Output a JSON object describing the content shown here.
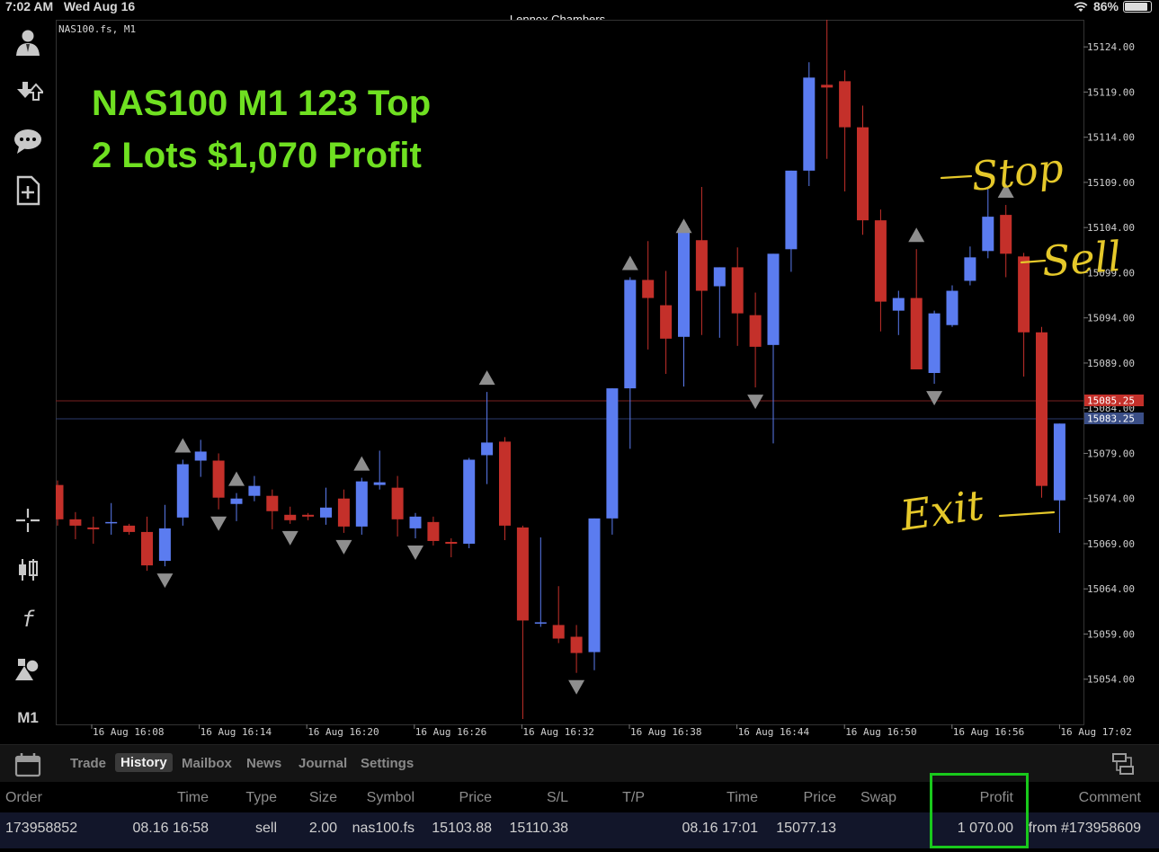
{
  "status_bar": {
    "time": "7:02 AM",
    "date": "Wed Aug 16",
    "account_name": "Lennox Chambers",
    "battery": "86%"
  },
  "chart": {
    "symbol_label": "NAS100.fs, M1",
    "overlay_title_1": "NAS100 M1 123 Top",
    "overlay_title_2": "2 Lots $1,070 Profit",
    "annotations": {
      "stop": "Stop",
      "sell": "Sell",
      "exit": "Exit"
    },
    "bid_label": "15085.25",
    "ask_label": "15083.25",
    "colors": {
      "bull": "#5b7cf0",
      "bear": "#c4302a",
      "arrow": "#8e8e8e",
      "overlay_text": "#6fe021",
      "annotation": "#e5c82a"
    }
  },
  "chart_data": {
    "type": "candlestick",
    "ylim": [
      15049,
      15127
    ],
    "y_ticks": [
      "15124.00",
      "15119.00",
      "15114.00",
      "15109.00",
      "15104.00",
      "15099.00",
      "15094.00",
      "15089.00",
      "15084.00",
      "15079.00",
      "15074.00",
      "15069.00",
      "15064.00",
      "15059.00",
      "15054.00"
    ],
    "x_ticks": [
      "16 Aug 16:08",
      "16 Aug 16:14",
      "16 Aug 16:20",
      "16 Aug 16:26",
      "16 Aug 16:32",
      "16 Aug 16:38",
      "16 Aug 16:44",
      "16 Aug 16:50",
      "16 Aug 16:56",
      "16 Aug 17:02"
    ],
    "candles": [
      {
        "o": 15075.5,
        "h": 15076,
        "l": 15071,
        "c": 15071.7
      },
      {
        "o": 15071.7,
        "h": 15072.5,
        "l": 15069.5,
        "c": 15071.0
      },
      {
        "o": 15070.8,
        "h": 15072,
        "l": 15069.0,
        "c": 15070.6
      },
      {
        "o": 15071.3,
        "h": 15073.5,
        "l": 15070,
        "c": 15071.4
      },
      {
        "o": 15071.0,
        "h": 15071.2,
        "l": 15070.0,
        "c": 15070.3
      },
      {
        "o": 15070.3,
        "h": 15072,
        "l": 15066.0,
        "c": 15066.6
      },
      {
        "o": 15067.1,
        "h": 15073.3,
        "l": 15066.5,
        "c": 15070.7
      },
      {
        "o": 15071.9,
        "h": 15078.3,
        "l": 15071,
        "c": 15077.8
      },
      {
        "o": 15078.2,
        "h": 15080.5,
        "l": 15076.4,
        "c": 15079.2
      },
      {
        "o": 15078.2,
        "h": 15079,
        "l": 15072.8,
        "c": 15074.1
      },
      {
        "o": 15073.4,
        "h": 15074.6,
        "l": 15071.5,
        "c": 15074.0
      },
      {
        "o": 15074.3,
        "h": 15076.5,
        "l": 15073.7,
        "c": 15075.4
      },
      {
        "o": 15074.3,
        "h": 15075.0,
        "l": 15070.6,
        "c": 15072.6
      },
      {
        "o": 15072.2,
        "h": 15073.1,
        "l": 15071.2,
        "c": 15071.6
      },
      {
        "o": 15072.2,
        "h": 15072.4,
        "l": 15071.6,
        "c": 15072.0
      },
      {
        "o": 15071.9,
        "h": 15075.2,
        "l": 15071.1,
        "c": 15073.0
      },
      {
        "o": 15074.0,
        "h": 15075.0,
        "l": 15070.2,
        "c": 15070.9
      },
      {
        "o": 15070.9,
        "h": 15076.3,
        "l": 15070.0,
        "c": 15075.9
      },
      {
        "o": 15075.5,
        "h": 15079.3,
        "l": 15075.0,
        "c": 15075.8
      },
      {
        "o": 15075.2,
        "h": 15076.5,
        "l": 15069.8,
        "c": 15071.7
      },
      {
        "o": 15070.7,
        "h": 15072.4,
        "l": 15069.6,
        "c": 15072.0
      },
      {
        "o": 15071.4,
        "h": 15072,
        "l": 15068.8,
        "c": 15069.3
      },
      {
        "o": 15069.2,
        "h": 15069.6,
        "l": 15067.5,
        "c": 15069.0
      },
      {
        "o": 15069.0,
        "h": 15078.5,
        "l": 15068.5,
        "c": 15078.3
      },
      {
        "o": 15078.8,
        "h": 15085.8,
        "l": 15075.6,
        "c": 15080.2
      },
      {
        "o": 15080.3,
        "h": 15080.8,
        "l": 15069.4,
        "c": 15071.0
      },
      {
        "o": 15070.8,
        "h": 15071,
        "l": 15049.6,
        "c": 15060.5
      },
      {
        "o": 15060.2,
        "h": 15069.7,
        "l": 15059.8,
        "c": 15060.3
      },
      {
        "o": 15060.0,
        "h": 15064.3,
        "l": 15058.0,
        "c": 15058.5
      },
      {
        "o": 15058.7,
        "h": 15060,
        "l": 15054.7,
        "c": 15056.9
      },
      {
        "o": 15057.0,
        "h": 15056.5,
        "l": 15055,
        "c": 15071.8
      },
      {
        "o": 15071.8,
        "h": 15073.5,
        "l": 15070,
        "c": 15086.2
      },
      {
        "o": 15086.2,
        "h": 15098.5,
        "l": 15079.5,
        "c": 15098.2
      },
      {
        "o": 15098.2,
        "h": 15102.5,
        "l": 15090.5,
        "c": 15096.2
      },
      {
        "o": 15095.4,
        "h": 15099.2,
        "l": 15087.8,
        "c": 15091.7
      },
      {
        "o": 15091.9,
        "h": 15102.6,
        "l": 15086.4,
        "c": 15103.9
      },
      {
        "o": 15102.6,
        "h": 15108.5,
        "l": 15092.1,
        "c": 15097.0
      },
      {
        "o": 15097.5,
        "h": 15098,
        "l": 15091.8,
        "c": 15099.6
      },
      {
        "o": 15099.6,
        "h": 15101.8,
        "l": 15090.9,
        "c": 15094.5
      },
      {
        "o": 15094.3,
        "h": 15096.8,
        "l": 15086.3,
        "c": 15090.8
      },
      {
        "o": 15091.0,
        "h": 15093.4,
        "l": 15080.1,
        "c": 15101.1
      },
      {
        "o": 15101.6,
        "h": 15104.7,
        "l": 15099.1,
        "c": 15110.3
      },
      {
        "o": 15110.3,
        "h": 15122.3,
        "l": 15108.6,
        "c": 15120.6
      },
      {
        "o": 15119.8,
        "h": 15127.4,
        "l": 15111.6,
        "c": 15119.5
      },
      {
        "o": 15120.2,
        "h": 15121.4,
        "l": 15108.0,
        "c": 15115.1
      },
      {
        "o": 15115.1,
        "h": 15117.5,
        "l": 15103.2,
        "c": 15104.8
      },
      {
        "o": 15104.8,
        "h": 15106.0,
        "l": 15092.5,
        "c": 15095.8
      },
      {
        "o": 15094.8,
        "h": 15097.0,
        "l": 15092.1,
        "c": 15096.2
      },
      {
        "o": 15096.2,
        "h": 15101.6,
        "l": 15088.8,
        "c": 15088.3
      },
      {
        "o": 15087.9,
        "h": 15094.8,
        "l": 15086.7,
        "c": 15094.5
      },
      {
        "o": 15093.2,
        "h": 15097.6,
        "l": 15093.0,
        "c": 15097.0
      },
      {
        "o": 15098.1,
        "h": 15101.9,
        "l": 15097.6,
        "c": 15100.7
      },
      {
        "o": 15101.4,
        "h": 15108.5,
        "l": 15100.6,
        "c": 15105.2
      },
      {
        "o": 15105.4,
        "h": 15106.5,
        "l": 15098.5,
        "c": 15101.1
      },
      {
        "o": 15100.8,
        "h": 15101.2,
        "l": 15087.5,
        "c": 15092.4
      },
      {
        "o": 15092.4,
        "h": 15093.0,
        "l": 15074.1,
        "c": 15075.4
      },
      {
        "o": 15073.8,
        "h": 15076.5,
        "l": 15070.2,
        "c": 15082.3
      }
    ],
    "up_arrows": [
      7,
      10,
      17,
      24,
      32,
      35,
      48,
      53
    ],
    "down_arrows": [
      6,
      9,
      13,
      16,
      20,
      29,
      39,
      49
    ]
  },
  "tabs": {
    "items": [
      "Trade",
      "History",
      "Mailbox",
      "News",
      "Journal",
      "Settings"
    ],
    "active": "History"
  },
  "table": {
    "headers": [
      "Order",
      "Time",
      "Type",
      "Size",
      "Symbol",
      "Price",
      "S/L",
      "T/P",
      "Time",
      "Price",
      "Swap",
      "Profit",
      "Comment"
    ],
    "row": [
      "173958852",
      "08.16 16:58",
      "sell",
      "2.00",
      "nas100.fs",
      "15103.88",
      "15110.38",
      "",
      "08.16 17:01",
      "15077.13",
      "",
      "1 070.00",
      "from #173958609"
    ]
  },
  "sidebar": {
    "timeframe": "M1"
  }
}
